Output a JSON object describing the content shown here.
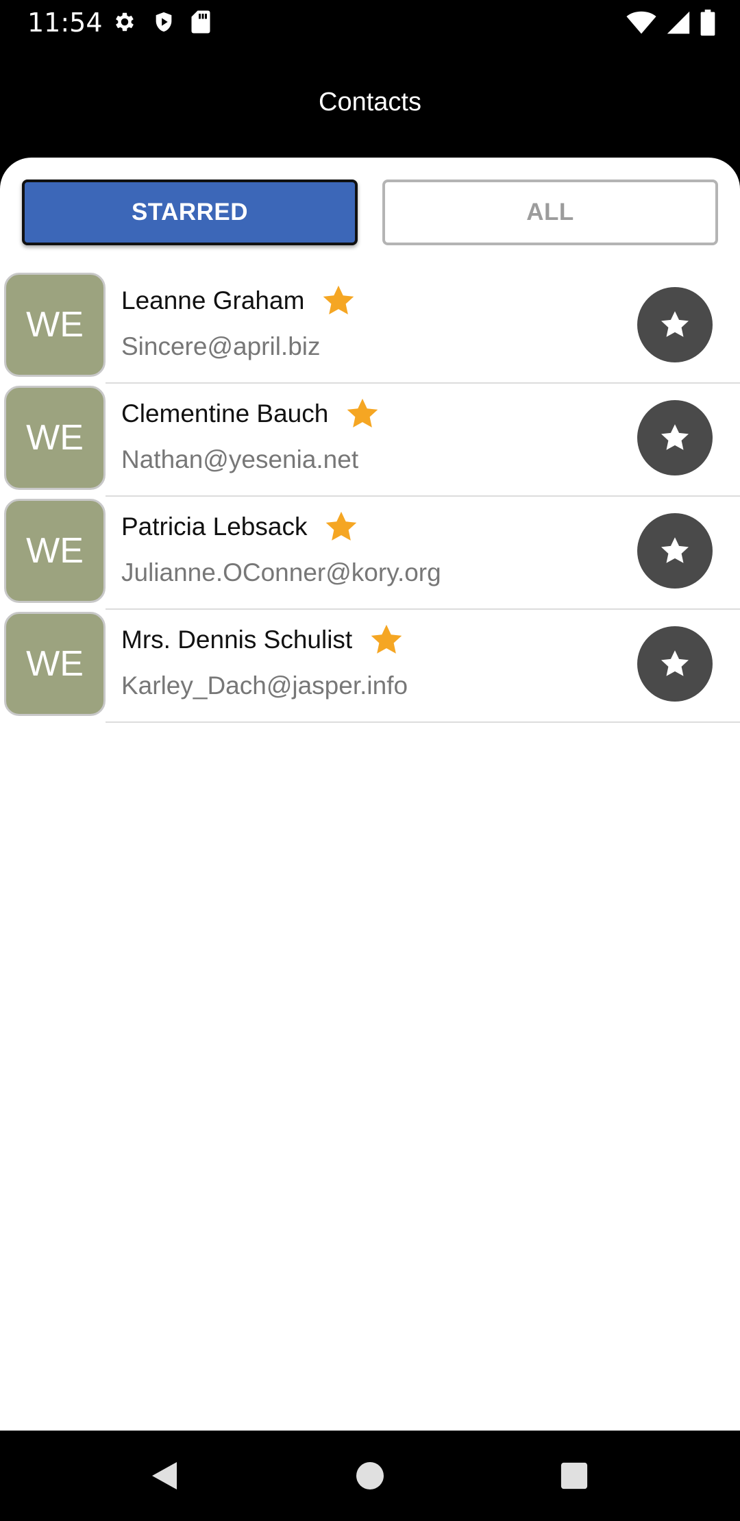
{
  "status_bar": {
    "time": "11:54",
    "left_icons": [
      "gear-icon",
      "shield-icon",
      "sd-card-icon"
    ],
    "right_icons": [
      "wifi-icon",
      "signal-icon",
      "battery-icon"
    ]
  },
  "app_bar": {
    "title": "Contacts"
  },
  "tabs": {
    "starred_label": "STARRED",
    "all_label": "ALL",
    "selected": "STARRED"
  },
  "contacts": [
    {
      "initials": "WE",
      "name": "Leanne Graham",
      "email": "Sincere@april.biz",
      "starred": true
    },
    {
      "initials": "WE",
      "name": "Clementine Bauch",
      "email": "Nathan@yesenia.net",
      "starred": true
    },
    {
      "initials": "WE",
      "name": "Patricia Lebsack",
      "email": "Julianne.OConner@kory.org",
      "starred": true
    },
    {
      "initials": "WE",
      "name": "Mrs. Dennis Schulist",
      "email": "Karley_Dach@jasper.info",
      "starred": true
    }
  ],
  "colors": {
    "accent": "#3c67b8",
    "avatar_bg": "#9ca37f",
    "star": "#f5a623",
    "star_button_bg": "#4a4a4a"
  },
  "nav_bar": {
    "buttons": [
      "back-icon",
      "home-icon",
      "recents-icon"
    ]
  }
}
